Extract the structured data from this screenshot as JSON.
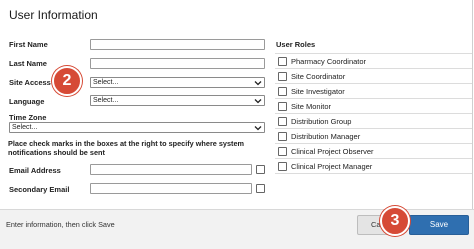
{
  "title": "User Information",
  "fields": {
    "first_name": "First Name",
    "last_name": "Last Name",
    "site_access": "Site Access",
    "site_access_value": "Select...",
    "language": "Language",
    "language_value": "Select...",
    "time_zone": "Time Zone",
    "time_zone_value": "Select...",
    "note": "Place check marks in the boxes at the right to specify where system notifications should be sent",
    "email": "Email Address",
    "secondary_email": "Secondary Email"
  },
  "roles": {
    "title": "User Roles",
    "items": [
      "Pharmacy Coordinator",
      "Site Coordinator",
      "Site Investigator",
      "Site Monitor",
      "Distribution Group",
      "Distribution Manager",
      "Clinical Project Observer",
      "Clinical Project Manager"
    ]
  },
  "footer": {
    "message": "Enter information, then click Save",
    "cancel_label": "Ca",
    "save_label": "Save"
  },
  "badges": {
    "step2": "2",
    "step3": "3"
  },
  "colors": {
    "primary": "#2f6fb0",
    "badge": "#d64a36"
  }
}
